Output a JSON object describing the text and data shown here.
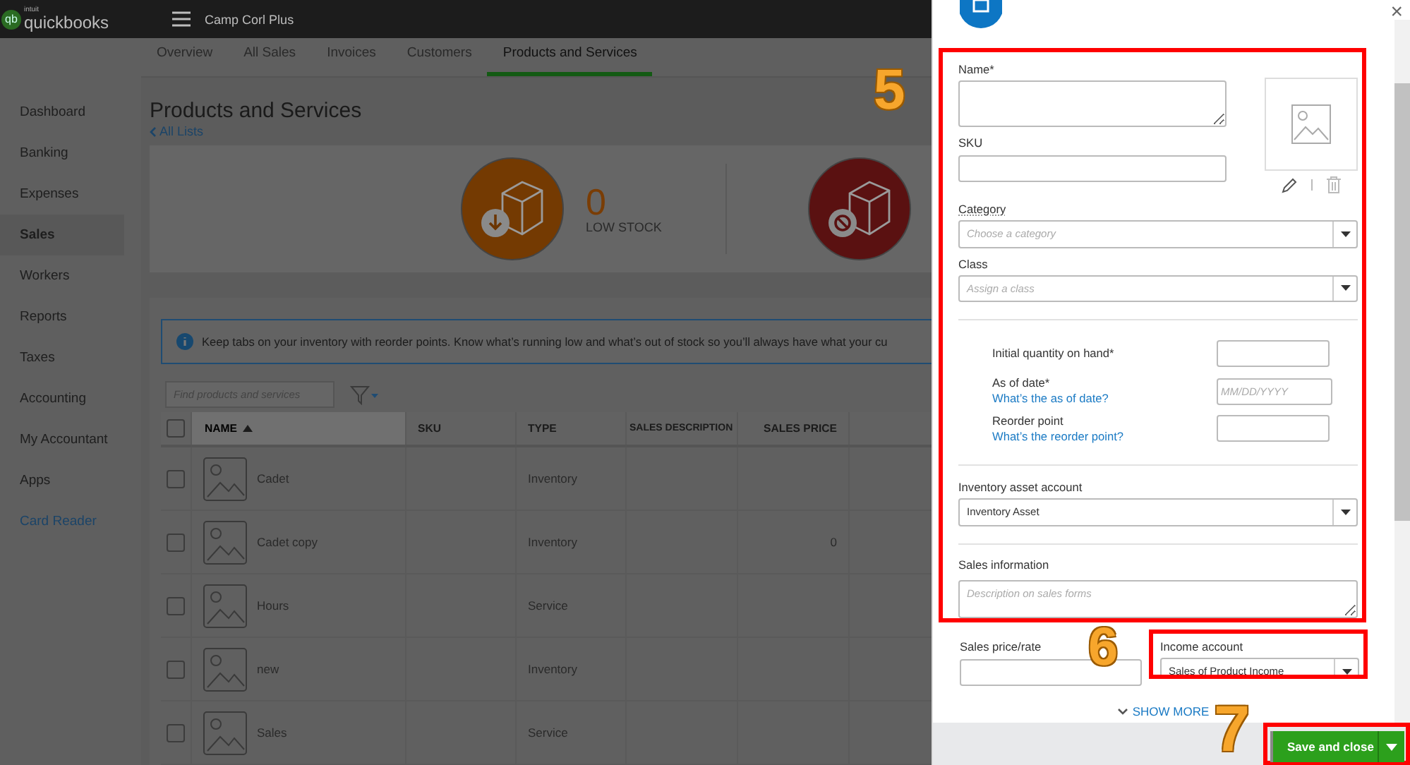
{
  "app": {
    "logo_mark": "qb",
    "logo_small": "intuit",
    "logo": "quickbooks",
    "company": "Camp Corl Plus"
  },
  "sidebar": {
    "items": [
      {
        "label": "Dashboard",
        "selected": false,
        "kind": "nav"
      },
      {
        "label": "Banking",
        "selected": false,
        "kind": "nav"
      },
      {
        "label": "Expenses",
        "selected": false,
        "kind": "nav"
      },
      {
        "label": "Sales",
        "selected": true,
        "kind": "nav"
      },
      {
        "label": "Workers",
        "selected": false,
        "kind": "nav"
      },
      {
        "label": "Reports",
        "selected": false,
        "kind": "nav"
      },
      {
        "label": "Taxes",
        "selected": false,
        "kind": "nav"
      },
      {
        "label": "Accounting",
        "selected": false,
        "kind": "nav"
      },
      {
        "label": "My Accountant",
        "selected": false,
        "kind": "nav"
      },
      {
        "label": "Apps",
        "selected": false,
        "kind": "nav"
      },
      {
        "label": "Card Reader",
        "selected": false,
        "kind": "link"
      }
    ]
  },
  "tabs": [
    {
      "label": "Overview",
      "selected": false
    },
    {
      "label": "All Sales",
      "selected": false
    },
    {
      "label": "Invoices",
      "selected": false
    },
    {
      "label": "Customers",
      "selected": false
    },
    {
      "label": "Products and Services",
      "selected": true
    }
  ],
  "page": {
    "title": "Products and Services",
    "back_link": "All Lists"
  },
  "stock_cards": [
    {
      "kind": "low",
      "count": "0",
      "label": "LOW STOCK"
    },
    {
      "kind": "out"
    }
  ],
  "info_banner": "Keep tabs on your inventory with reorder points. Know what’s running low and what’s out of stock so you’ll always have what your cu",
  "search": {
    "placeholder": "Find products and services"
  },
  "table": {
    "select_all_checked": false,
    "columns": [
      {
        "label": "NAME",
        "sorted": true
      },
      {
        "label": "SKU",
        "sorted": false
      },
      {
        "label": "TYPE",
        "sorted": false
      },
      {
        "label": "SALES DESCRIPTION",
        "sorted": false
      },
      {
        "label": "SALES PRICE",
        "sorted": false
      }
    ],
    "rows": [
      {
        "name": "Cadet",
        "type": "Inventory",
        "sales_price": "",
        "checked": false
      },
      {
        "name": "Cadet copy",
        "type": "Inventory",
        "sales_price": "0",
        "checked": false
      },
      {
        "name": "Hours",
        "type": "Service",
        "sales_price": "",
        "checked": false
      },
      {
        "name": "new",
        "type": "Inventory",
        "sales_price": "",
        "checked": false
      },
      {
        "name": "Sales",
        "type": "Service",
        "sales_price": "",
        "checked": false
      }
    ]
  },
  "panel": {
    "close": "×",
    "name": {
      "label": "Name*"
    },
    "sku": {
      "label": "SKU"
    },
    "category": {
      "label": "Category",
      "placeholder": "Choose a category"
    },
    "class": {
      "label": "Class",
      "placeholder": "Assign a class"
    },
    "quantity": {
      "label": "Initial quantity on hand*"
    },
    "as_of": {
      "label": "As of date*",
      "help": "What’s the as of date?",
      "placeholder": "MM/DD/YYYY"
    },
    "reorder": {
      "label": "Reorder point",
      "help": "What’s the reorder point?"
    },
    "asset_account": {
      "label": "Inventory asset account",
      "value": "Inventory Asset"
    },
    "sales_info": {
      "label": "Sales information",
      "placeholder": "Description on sales forms"
    },
    "price": {
      "label": "Sales price/rate"
    },
    "income": {
      "label": "Income account",
      "value": "Sales of Product Income"
    },
    "show_more": "SHOW MORE",
    "save_button": "Save and close"
  },
  "annotations": [
    {
      "label": "5"
    },
    {
      "label": "6"
    },
    {
      "label": "7"
    }
  ]
}
